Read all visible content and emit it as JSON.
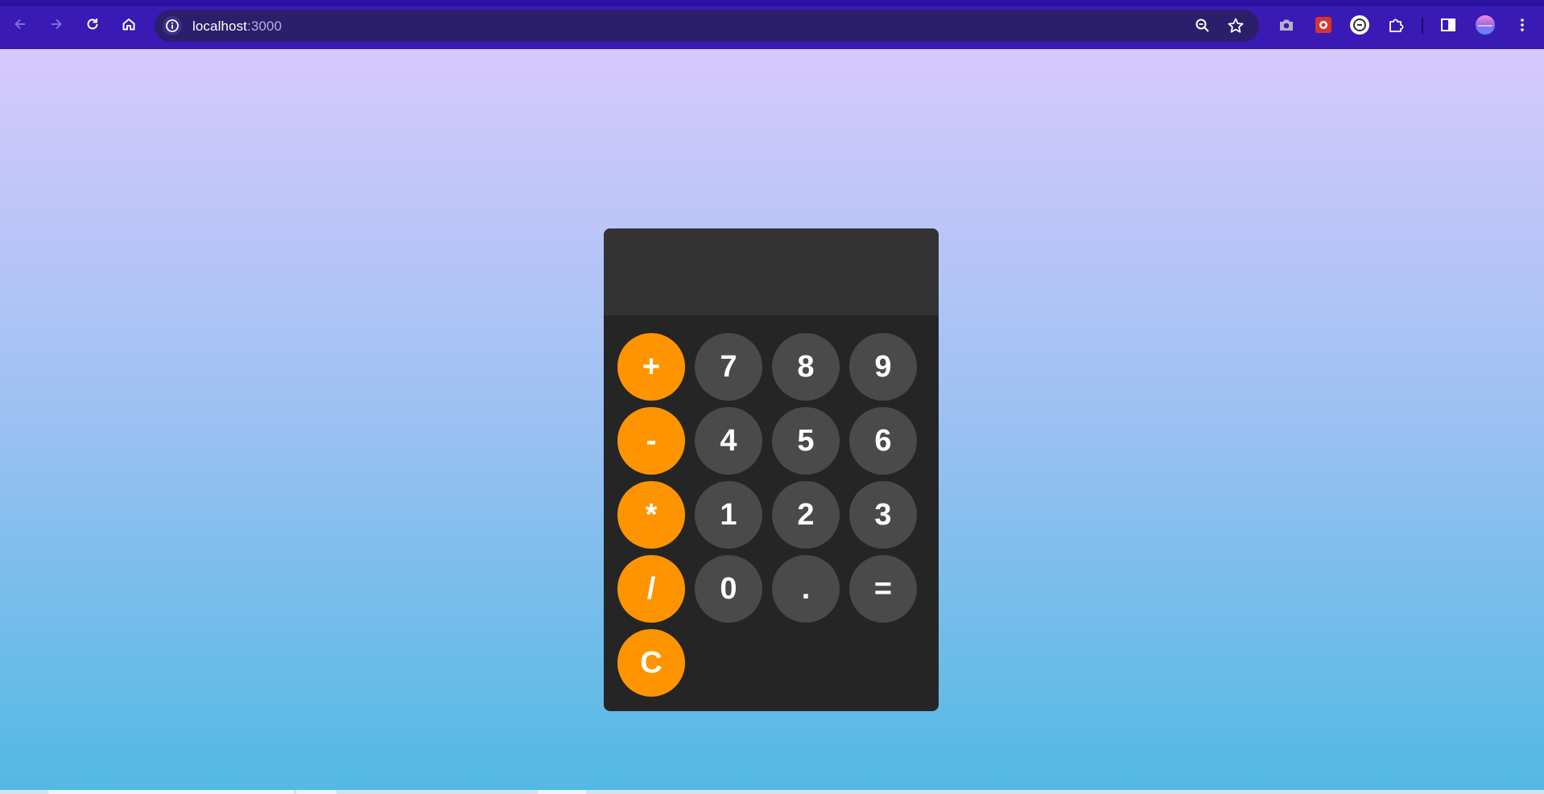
{
  "browser": {
    "url_host": "localhost",
    "url_port": ":3000",
    "icons": {
      "back": "arrow-left-icon",
      "forward": "arrow-right-icon",
      "reload": "reload-icon",
      "home": "home-icon",
      "site_info": "info-icon",
      "zoom": "zoom-out-icon",
      "bookmark": "star-icon",
      "screenshot": "camera-icon",
      "extension_1": "red-extension-icon",
      "extension_2": "circle-extension-icon",
      "extensions": "puzzle-icon",
      "side_panel": "side-panel-icon",
      "profile": "avatar-icon",
      "menu": "kebab-menu-icon"
    },
    "colors": {
      "chrome": "#3a1ab5",
      "omnibox": "#2b1e6b"
    }
  },
  "calculator": {
    "display_value": "",
    "colors": {
      "body": "#252525",
      "display": "#333333",
      "operator": "#fe9500",
      "number": "#4a4a4a"
    },
    "operators": [
      {
        "label": "+",
        "name": "add-button"
      },
      {
        "label": "-",
        "name": "subtract-button"
      },
      {
        "label": "*",
        "name": "multiply-button"
      },
      {
        "label": "/",
        "name": "divide-button"
      },
      {
        "label": "C",
        "name": "clear-button"
      }
    ],
    "rows": [
      [
        "7",
        "8",
        "9"
      ],
      [
        "4",
        "5",
        "6"
      ],
      [
        "1",
        "2",
        "3"
      ],
      [
        "0",
        ".",
        "="
      ]
    ]
  }
}
